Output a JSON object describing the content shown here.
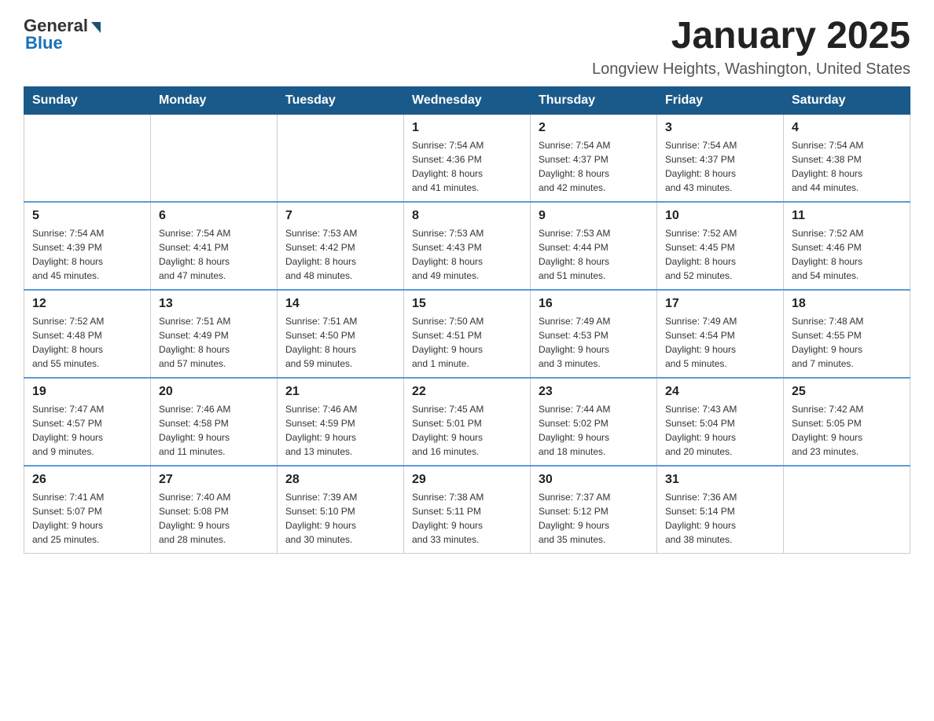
{
  "header": {
    "logo": {
      "general": "General",
      "blue": "Blue"
    },
    "title": "January 2025",
    "location": "Longview Heights, Washington, United States"
  },
  "weekdays": [
    "Sunday",
    "Monday",
    "Tuesday",
    "Wednesday",
    "Thursday",
    "Friday",
    "Saturday"
  ],
  "weeks": [
    [
      {
        "day": "",
        "info": ""
      },
      {
        "day": "",
        "info": ""
      },
      {
        "day": "",
        "info": ""
      },
      {
        "day": "1",
        "info": "Sunrise: 7:54 AM\nSunset: 4:36 PM\nDaylight: 8 hours\nand 41 minutes."
      },
      {
        "day": "2",
        "info": "Sunrise: 7:54 AM\nSunset: 4:37 PM\nDaylight: 8 hours\nand 42 minutes."
      },
      {
        "day": "3",
        "info": "Sunrise: 7:54 AM\nSunset: 4:37 PM\nDaylight: 8 hours\nand 43 minutes."
      },
      {
        "day": "4",
        "info": "Sunrise: 7:54 AM\nSunset: 4:38 PM\nDaylight: 8 hours\nand 44 minutes."
      }
    ],
    [
      {
        "day": "5",
        "info": "Sunrise: 7:54 AM\nSunset: 4:39 PM\nDaylight: 8 hours\nand 45 minutes."
      },
      {
        "day": "6",
        "info": "Sunrise: 7:54 AM\nSunset: 4:41 PM\nDaylight: 8 hours\nand 47 minutes."
      },
      {
        "day": "7",
        "info": "Sunrise: 7:53 AM\nSunset: 4:42 PM\nDaylight: 8 hours\nand 48 minutes."
      },
      {
        "day": "8",
        "info": "Sunrise: 7:53 AM\nSunset: 4:43 PM\nDaylight: 8 hours\nand 49 minutes."
      },
      {
        "day": "9",
        "info": "Sunrise: 7:53 AM\nSunset: 4:44 PM\nDaylight: 8 hours\nand 51 minutes."
      },
      {
        "day": "10",
        "info": "Sunrise: 7:52 AM\nSunset: 4:45 PM\nDaylight: 8 hours\nand 52 minutes."
      },
      {
        "day": "11",
        "info": "Sunrise: 7:52 AM\nSunset: 4:46 PM\nDaylight: 8 hours\nand 54 minutes."
      }
    ],
    [
      {
        "day": "12",
        "info": "Sunrise: 7:52 AM\nSunset: 4:48 PM\nDaylight: 8 hours\nand 55 minutes."
      },
      {
        "day": "13",
        "info": "Sunrise: 7:51 AM\nSunset: 4:49 PM\nDaylight: 8 hours\nand 57 minutes."
      },
      {
        "day": "14",
        "info": "Sunrise: 7:51 AM\nSunset: 4:50 PM\nDaylight: 8 hours\nand 59 minutes."
      },
      {
        "day": "15",
        "info": "Sunrise: 7:50 AM\nSunset: 4:51 PM\nDaylight: 9 hours\nand 1 minute."
      },
      {
        "day": "16",
        "info": "Sunrise: 7:49 AM\nSunset: 4:53 PM\nDaylight: 9 hours\nand 3 minutes."
      },
      {
        "day": "17",
        "info": "Sunrise: 7:49 AM\nSunset: 4:54 PM\nDaylight: 9 hours\nand 5 minutes."
      },
      {
        "day": "18",
        "info": "Sunrise: 7:48 AM\nSunset: 4:55 PM\nDaylight: 9 hours\nand 7 minutes."
      }
    ],
    [
      {
        "day": "19",
        "info": "Sunrise: 7:47 AM\nSunset: 4:57 PM\nDaylight: 9 hours\nand 9 minutes."
      },
      {
        "day": "20",
        "info": "Sunrise: 7:46 AM\nSunset: 4:58 PM\nDaylight: 9 hours\nand 11 minutes."
      },
      {
        "day": "21",
        "info": "Sunrise: 7:46 AM\nSunset: 4:59 PM\nDaylight: 9 hours\nand 13 minutes."
      },
      {
        "day": "22",
        "info": "Sunrise: 7:45 AM\nSunset: 5:01 PM\nDaylight: 9 hours\nand 16 minutes."
      },
      {
        "day": "23",
        "info": "Sunrise: 7:44 AM\nSunset: 5:02 PM\nDaylight: 9 hours\nand 18 minutes."
      },
      {
        "day": "24",
        "info": "Sunrise: 7:43 AM\nSunset: 5:04 PM\nDaylight: 9 hours\nand 20 minutes."
      },
      {
        "day": "25",
        "info": "Sunrise: 7:42 AM\nSunset: 5:05 PM\nDaylight: 9 hours\nand 23 minutes."
      }
    ],
    [
      {
        "day": "26",
        "info": "Sunrise: 7:41 AM\nSunset: 5:07 PM\nDaylight: 9 hours\nand 25 minutes."
      },
      {
        "day": "27",
        "info": "Sunrise: 7:40 AM\nSunset: 5:08 PM\nDaylight: 9 hours\nand 28 minutes."
      },
      {
        "day": "28",
        "info": "Sunrise: 7:39 AM\nSunset: 5:10 PM\nDaylight: 9 hours\nand 30 minutes."
      },
      {
        "day": "29",
        "info": "Sunrise: 7:38 AM\nSunset: 5:11 PM\nDaylight: 9 hours\nand 33 minutes."
      },
      {
        "day": "30",
        "info": "Sunrise: 7:37 AM\nSunset: 5:12 PM\nDaylight: 9 hours\nand 35 minutes."
      },
      {
        "day": "31",
        "info": "Sunrise: 7:36 AM\nSunset: 5:14 PM\nDaylight: 9 hours\nand 38 minutes."
      },
      {
        "day": "",
        "info": ""
      }
    ]
  ]
}
